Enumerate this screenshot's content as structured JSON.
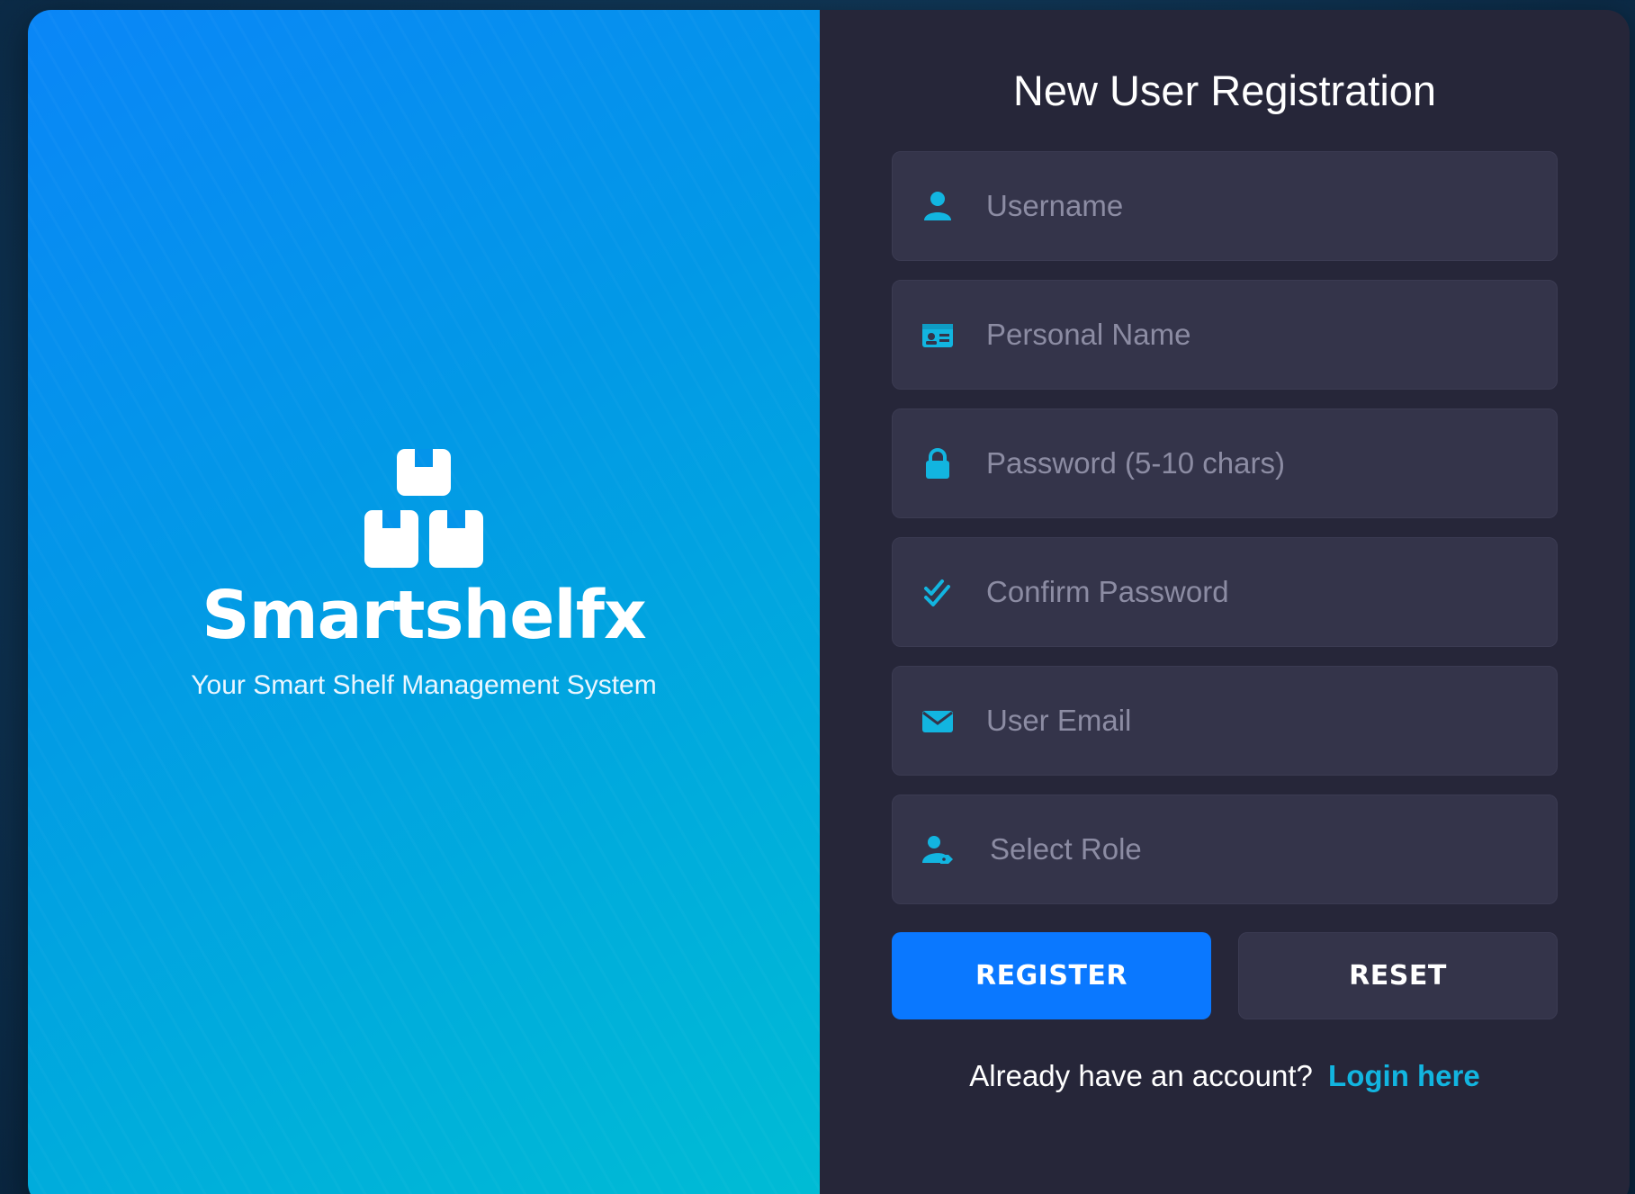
{
  "brand": {
    "name": "Smartshelfx",
    "tagline": "Your Smart Shelf Management System"
  },
  "form": {
    "title": "New User Registration",
    "fields": {
      "username": {
        "placeholder": "Username",
        "icon": "user-icon"
      },
      "personal_name": {
        "placeholder": "Personal Name",
        "icon": "id-card-icon"
      },
      "password": {
        "placeholder": "Password (5-10 chars)",
        "icon": "lock-icon"
      },
      "confirm_password": {
        "placeholder": "Confirm Password",
        "icon": "check-double-icon"
      },
      "email": {
        "placeholder": "User Email",
        "icon": "envelope-icon"
      },
      "role": {
        "label": "Select Role",
        "icon": "user-tag-icon"
      }
    },
    "buttons": {
      "register": "REGISTER",
      "reset": "RESET"
    },
    "login_prompt": "Already have an account?",
    "login_link": "Login here"
  },
  "colors": {
    "accent": "#0a78ff",
    "icon": "#12b5e0",
    "panel": "#262639",
    "field": "#34344a"
  }
}
